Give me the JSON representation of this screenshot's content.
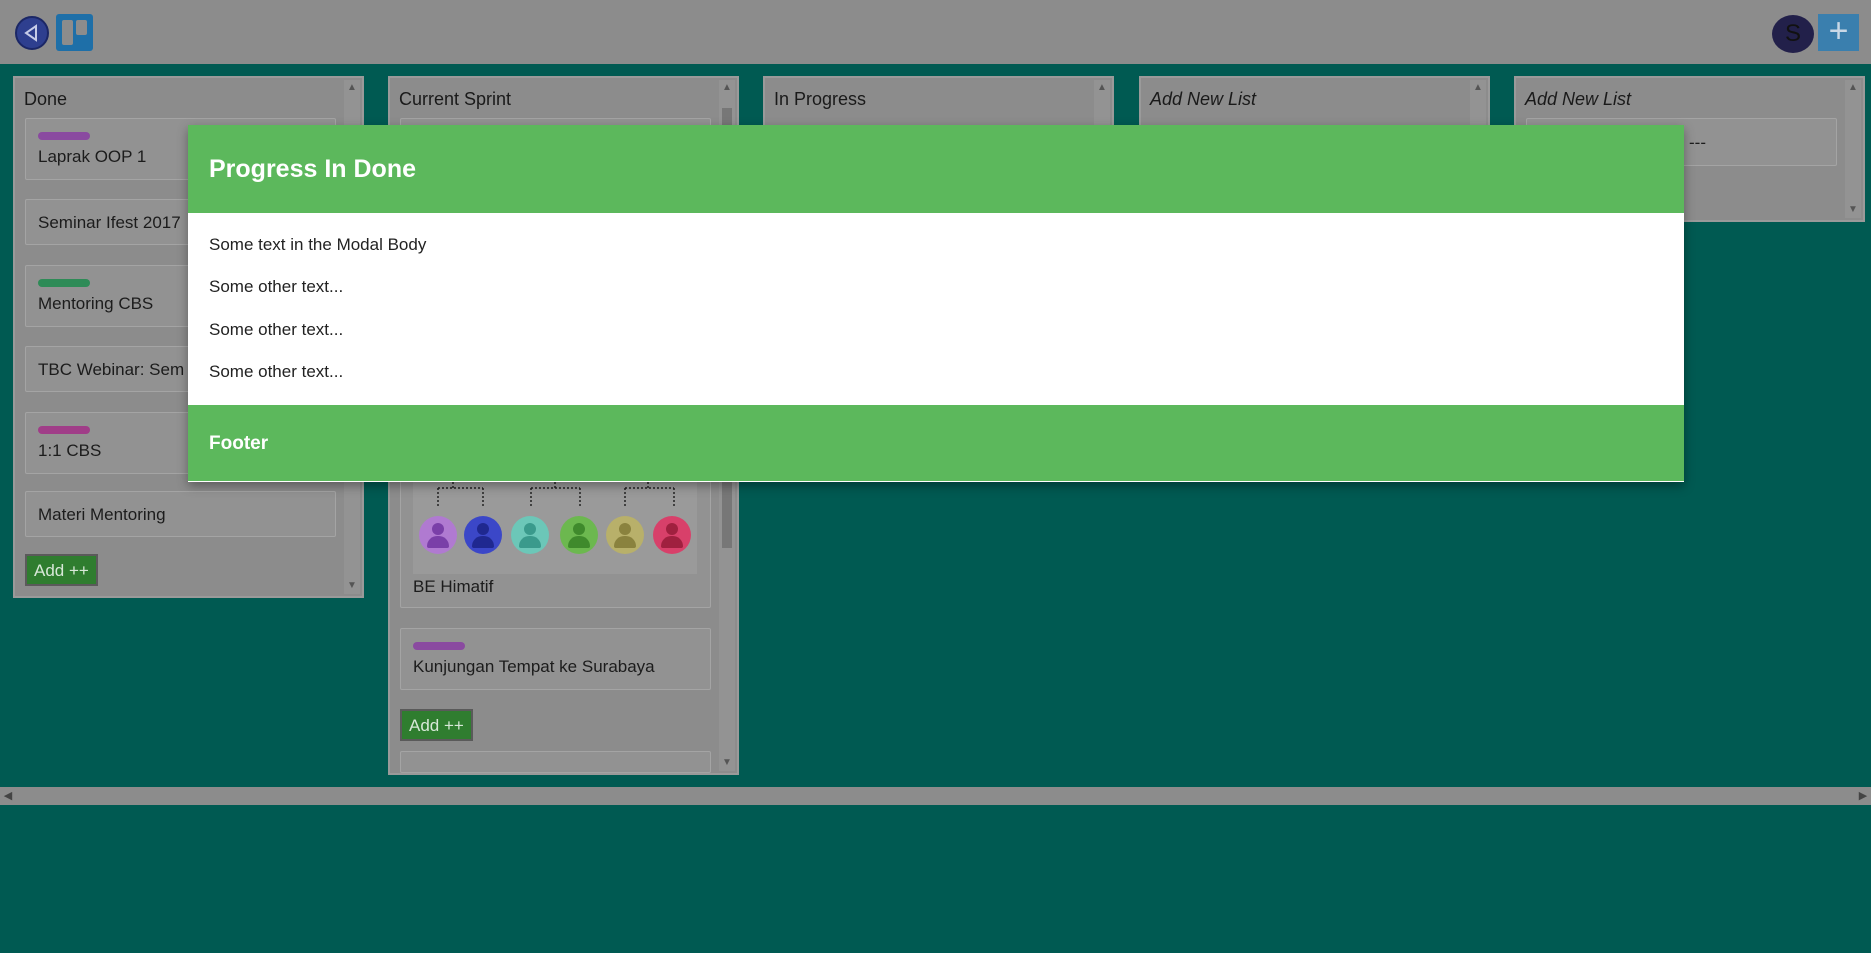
{
  "topbar": {
    "back_icon": "back-arrow-icon",
    "board_icon": "board-icon",
    "avatar_letter": "S",
    "add_icon": "+"
  },
  "lists": [
    {
      "title": "Done",
      "italic": false
    },
    {
      "title": "Current Sprint",
      "italic": false
    },
    {
      "title": "In Progress",
      "italic": false
    },
    {
      "title": "Add New List",
      "italic": true
    },
    {
      "title": "Add New List",
      "italic": true
    }
  ],
  "done_cards": [
    {
      "text": "Laprak OOP 1",
      "label_color": "#8a4aa0"
    },
    {
      "text": "Seminar Ifest 2017",
      "label_color": ""
    },
    {
      "text": "Mentoring CBS",
      "label_color": "#2e8b57"
    },
    {
      "text": "TBC Webinar: Sem",
      "label_color": ""
    },
    {
      "text": "1:1 CBS",
      "label_color": "#a03d88"
    },
    {
      "text": "Materi Mentoring",
      "label_color": ""
    }
  ],
  "sprint_cards": [
    {
      "text": "BE Himatif",
      "label_color": ""
    },
    {
      "text": "Kunjungan Tempat ke Surabaya",
      "label_color": "#8a4aa0"
    }
  ],
  "add_button_label": "Add ++",
  "list5_partial_text": "---",
  "modal": {
    "title": "Progress In Done",
    "body": [
      "Some text in the Modal Body",
      "Some other text...",
      "Some other text...",
      "Some other text..."
    ],
    "footer": "Footer"
  },
  "colors": {
    "background": "#005a52",
    "modal_green": "#5cb85c",
    "add_button": "#2f7d2f"
  }
}
